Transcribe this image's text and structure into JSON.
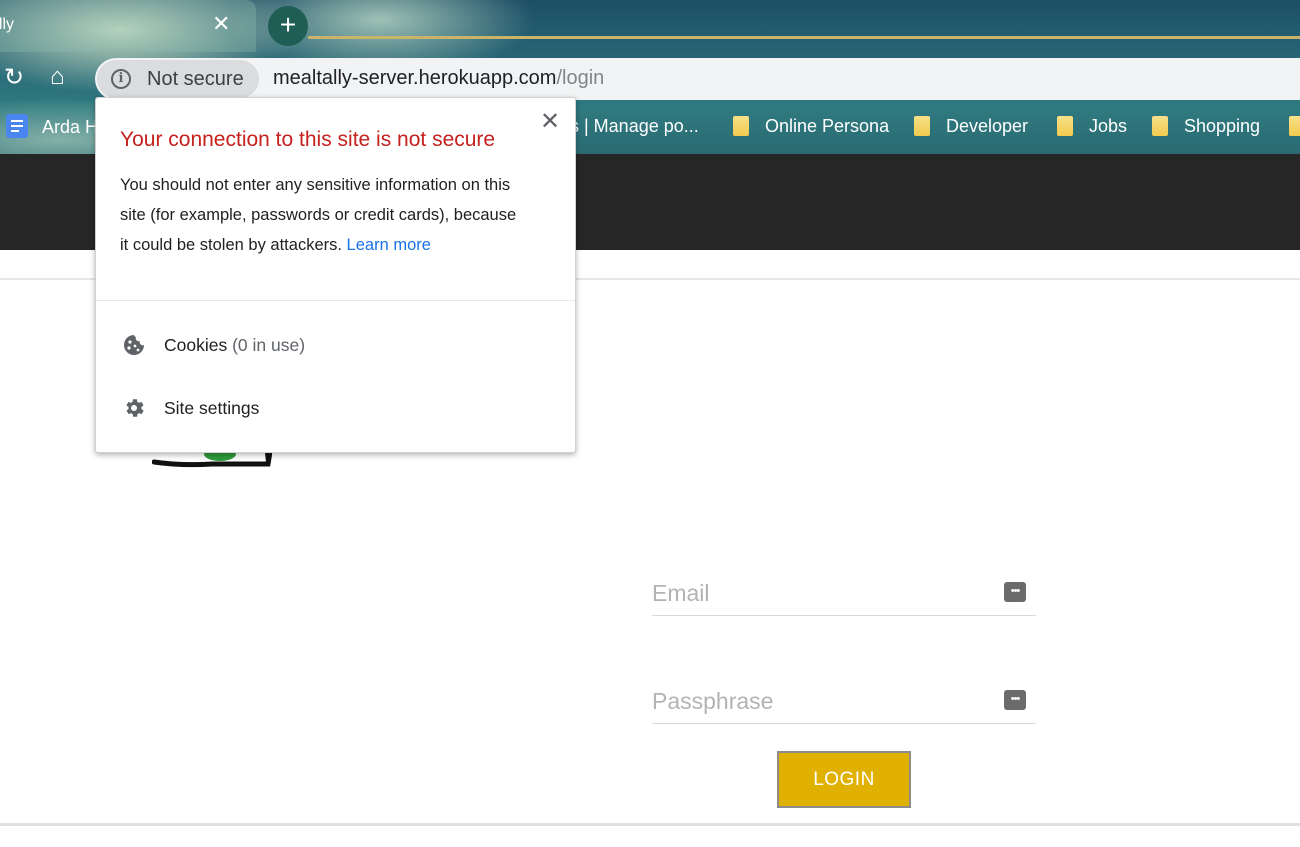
{
  "browser": {
    "tab_title": "ally",
    "tab_close": "✕",
    "new_tab": "+",
    "security_chip": "Not secure",
    "url_host": "mealtally-server.herokuapp.com",
    "url_path": "/login",
    "bookmarks": [
      {
        "label": "Arda H",
        "icon": "doc-icon"
      },
      {
        "label": "ts | Manage po...",
        "icon": "none"
      },
      {
        "label": "Online Persona",
        "icon": "folder-icon"
      },
      {
        "label": "Developer",
        "icon": "folder-icon"
      },
      {
        "label": "Jobs",
        "icon": "folder-icon"
      },
      {
        "label": "Shopping",
        "icon": "folder-icon"
      }
    ]
  },
  "security_popup": {
    "close": "✕",
    "title": "Your connection to this site is not secure",
    "body_line1": "You should not enter any sensitive information on this",
    "body_line2": "site (for example, passwords or credit cards), because",
    "body_line3": "it could be stolen by attackers.",
    "learn_more": "Learn more",
    "cookies_label": "Cookies",
    "cookies_count": "(0 in use)",
    "site_settings_label": "Site settings"
  },
  "login_form": {
    "email_placeholder": "Email",
    "passphrase_placeholder": "Passphrase",
    "login_button": "LOGIN"
  },
  "colors": {
    "warning_title": "#c5221f",
    "link": "#1a73e8",
    "login_button": "#e0b100",
    "site_header": "#262626"
  }
}
